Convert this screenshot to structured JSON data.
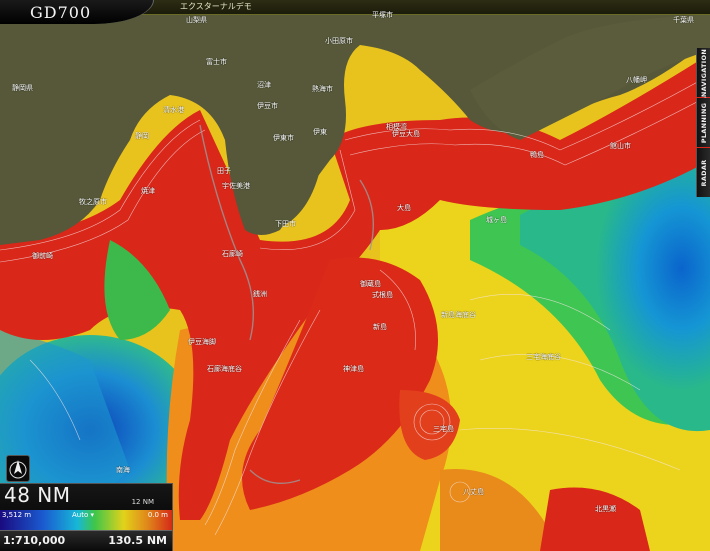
{
  "app": {
    "title": "エクスターナルデモ",
    "logo": "GD700"
  },
  "side_tabs": [
    "NAVIGATION",
    "PLANNING",
    "RADAR"
  ],
  "range": {
    "main": "48 NM",
    "sub": "12 NM"
  },
  "depth_scale": {
    "left": "3,512 m",
    "mid": "Auto ▾",
    "right": "0.0 m"
  },
  "bottom": {
    "scale": "1:710,000",
    "distance": "130.5 NM"
  },
  "compass_icon": "north-arrow-icon",
  "colors": {
    "land": "#54563a",
    "shallow": "#d92a18",
    "mid": "#f0d21b",
    "deep": "#1a8ad8"
  },
  "place_labels": [
    "山梨県",
    "平塚市",
    "千葉県",
    "静岡県",
    "富士市",
    "沼津",
    "熱海市",
    "小田原市",
    "八幡岬",
    "清水港",
    "伊東",
    "伊豆大島",
    "鴨島",
    "静岡",
    "伊豆市",
    "相模湾",
    "伊東市",
    "館山市",
    "焼津",
    "田子",
    "城ヶ島",
    "牧之原市",
    "宇佐美港",
    "下田市",
    "大島",
    "御前崎",
    "石廊崎",
    "銭洲",
    "御蔵島",
    "新島",
    "式根島",
    "新島海底谷",
    "三宅海底谷",
    "伊豆海脚",
    "石廊海底谷",
    "神津島",
    "南海",
    "三宅島",
    "八丈島",
    "北黒瀬"
  ]
}
